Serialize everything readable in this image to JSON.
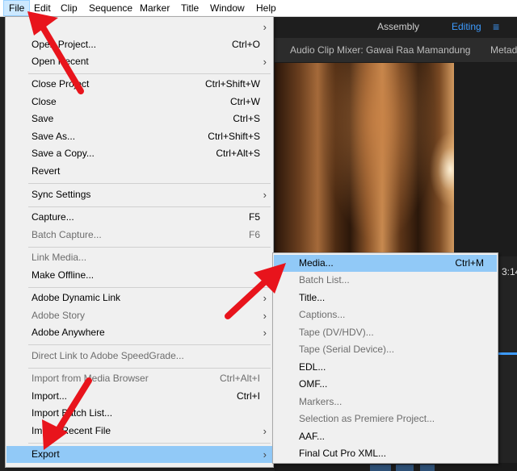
{
  "menubar": [
    "File",
    "Edit",
    "Clip",
    "Sequence",
    "Marker",
    "Title",
    "Window",
    "Help"
  ],
  "workspace": {
    "assembly": "Assembly",
    "editing": "Editing",
    "menu_glyph": "≡"
  },
  "panel": {
    "audio_mixer_tab": "Audio Clip Mixer: Gawai Raa Mamandung",
    "metadata_tab": "Metad",
    "timecode_fragment": "3:14"
  },
  "file_menu": {
    "new_item_truncated": "N",
    "open_project": {
      "label": "Open Project...",
      "shortcut": "Ctrl+O"
    },
    "open_recent": "Open Recent",
    "close_project": {
      "label": "Close Project",
      "shortcut": "Ctrl+Shift+W"
    },
    "close": {
      "label": "Close",
      "shortcut": "Ctrl+W"
    },
    "save": {
      "label": "Save",
      "shortcut": "Ctrl+S"
    },
    "save_as": {
      "label": "Save As...",
      "shortcut": "Ctrl+Shift+S"
    },
    "save_copy": {
      "label": "Save a Copy...",
      "shortcut": "Ctrl+Alt+S"
    },
    "revert": "Revert",
    "sync_settings": "Sync Settings",
    "capture": {
      "label": "Capture...",
      "shortcut": "F5"
    },
    "batch_capture": {
      "label": "Batch Capture...",
      "shortcut": "F6"
    },
    "link_media": "Link Media...",
    "make_offline": "Make Offline...",
    "dynamic_link": "Adobe Dynamic Link",
    "adobe_story": "Adobe Story",
    "adobe_anywhere": "Adobe Anywhere",
    "direct_link": "Direct Link to Adobe SpeedGrade...",
    "import_browser": {
      "label": "Import from Media Browser",
      "shortcut": "Ctrl+Alt+I"
    },
    "import": {
      "label": "Import...",
      "shortcut": "Ctrl+I"
    },
    "import_batch": "Import Batch List...",
    "import_recent": "Import Recent File",
    "export": "Export"
  },
  "export_submenu": {
    "media": {
      "label": "Media...",
      "shortcut": "Ctrl+M"
    },
    "batch_list": "Batch List...",
    "title": "Title...",
    "captions": "Captions...",
    "tape_dv": "Tape (DV/HDV)...",
    "tape_serial": "Tape (Serial Device)...",
    "edl": "EDL...",
    "omf": "OMF...",
    "markers": "Markers...",
    "selection_project": "Selection as Premiere Project...",
    "aaf": "AAF...",
    "fcp_xml": "Final Cut Pro XML..."
  },
  "colors": {
    "menu_bg": "#f0f0f0",
    "highlight": "#91c9f7",
    "annotation_arrow": "#e8141c",
    "workspace_accent": "#3d9bff"
  }
}
